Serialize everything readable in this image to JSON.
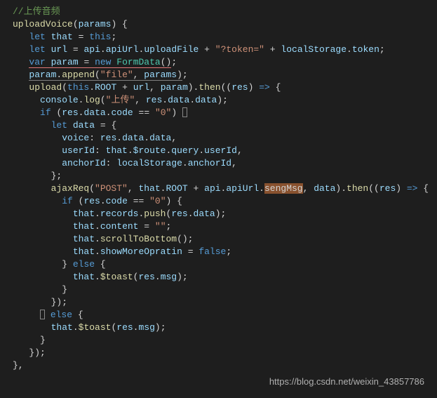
{
  "code": {
    "comment": "//上传音频",
    "fn_name": "uploadVoice",
    "params": "params",
    "that_decl": "let that = this;",
    "url_decl_kw": "let",
    "url_var": "url",
    "api_path": "api.apiUrl.uploadFile",
    "token_str": "\"?token=\"",
    "local_token": "localStorage.token",
    "var_kw": "var",
    "param_var": "param",
    "new_kw": "new",
    "formdata": "FormData",
    "append_call": "param.append",
    "file_str": "\"file\"",
    "upload_fn": "upload",
    "this_kw": "this",
    "root": "ROOT",
    "then_kw": "then",
    "res": "res",
    "console_log": "console.log",
    "upload_str": "\"上传\"",
    "res_data_data": "res.data.data",
    "if_kw": "if",
    "res_code": "res.data.code",
    "eq": " == ",
    "zero_str": "\"0\"",
    "data_var": "data",
    "voice_key": "voice",
    "userid_key": "userId",
    "that_route": "that.$route.query.userId",
    "anchorid_key": "anchorId",
    "local_anchor": "localStorage.anchorId",
    "ajax_fn": "ajaxReq",
    "post_str": "\"POST\"",
    "that_root": "that.ROOT",
    "sengmsg": "sengMsg",
    "api_url": "api.apiUrl",
    "res_code2": "res.code",
    "records_push": "that.records.push",
    "res_data": "res.data",
    "content": "that.content",
    "empty_str": "\"\"",
    "scroll_fn": "that.scrollToBottom",
    "showmore": "that.showMoreOpratin",
    "false_kw": "false",
    "else_kw": "else",
    "toast": "that.$toast",
    "res_msg": "res.msg"
  },
  "watermark": "https://blog.csdn.net/weixin_43857786"
}
